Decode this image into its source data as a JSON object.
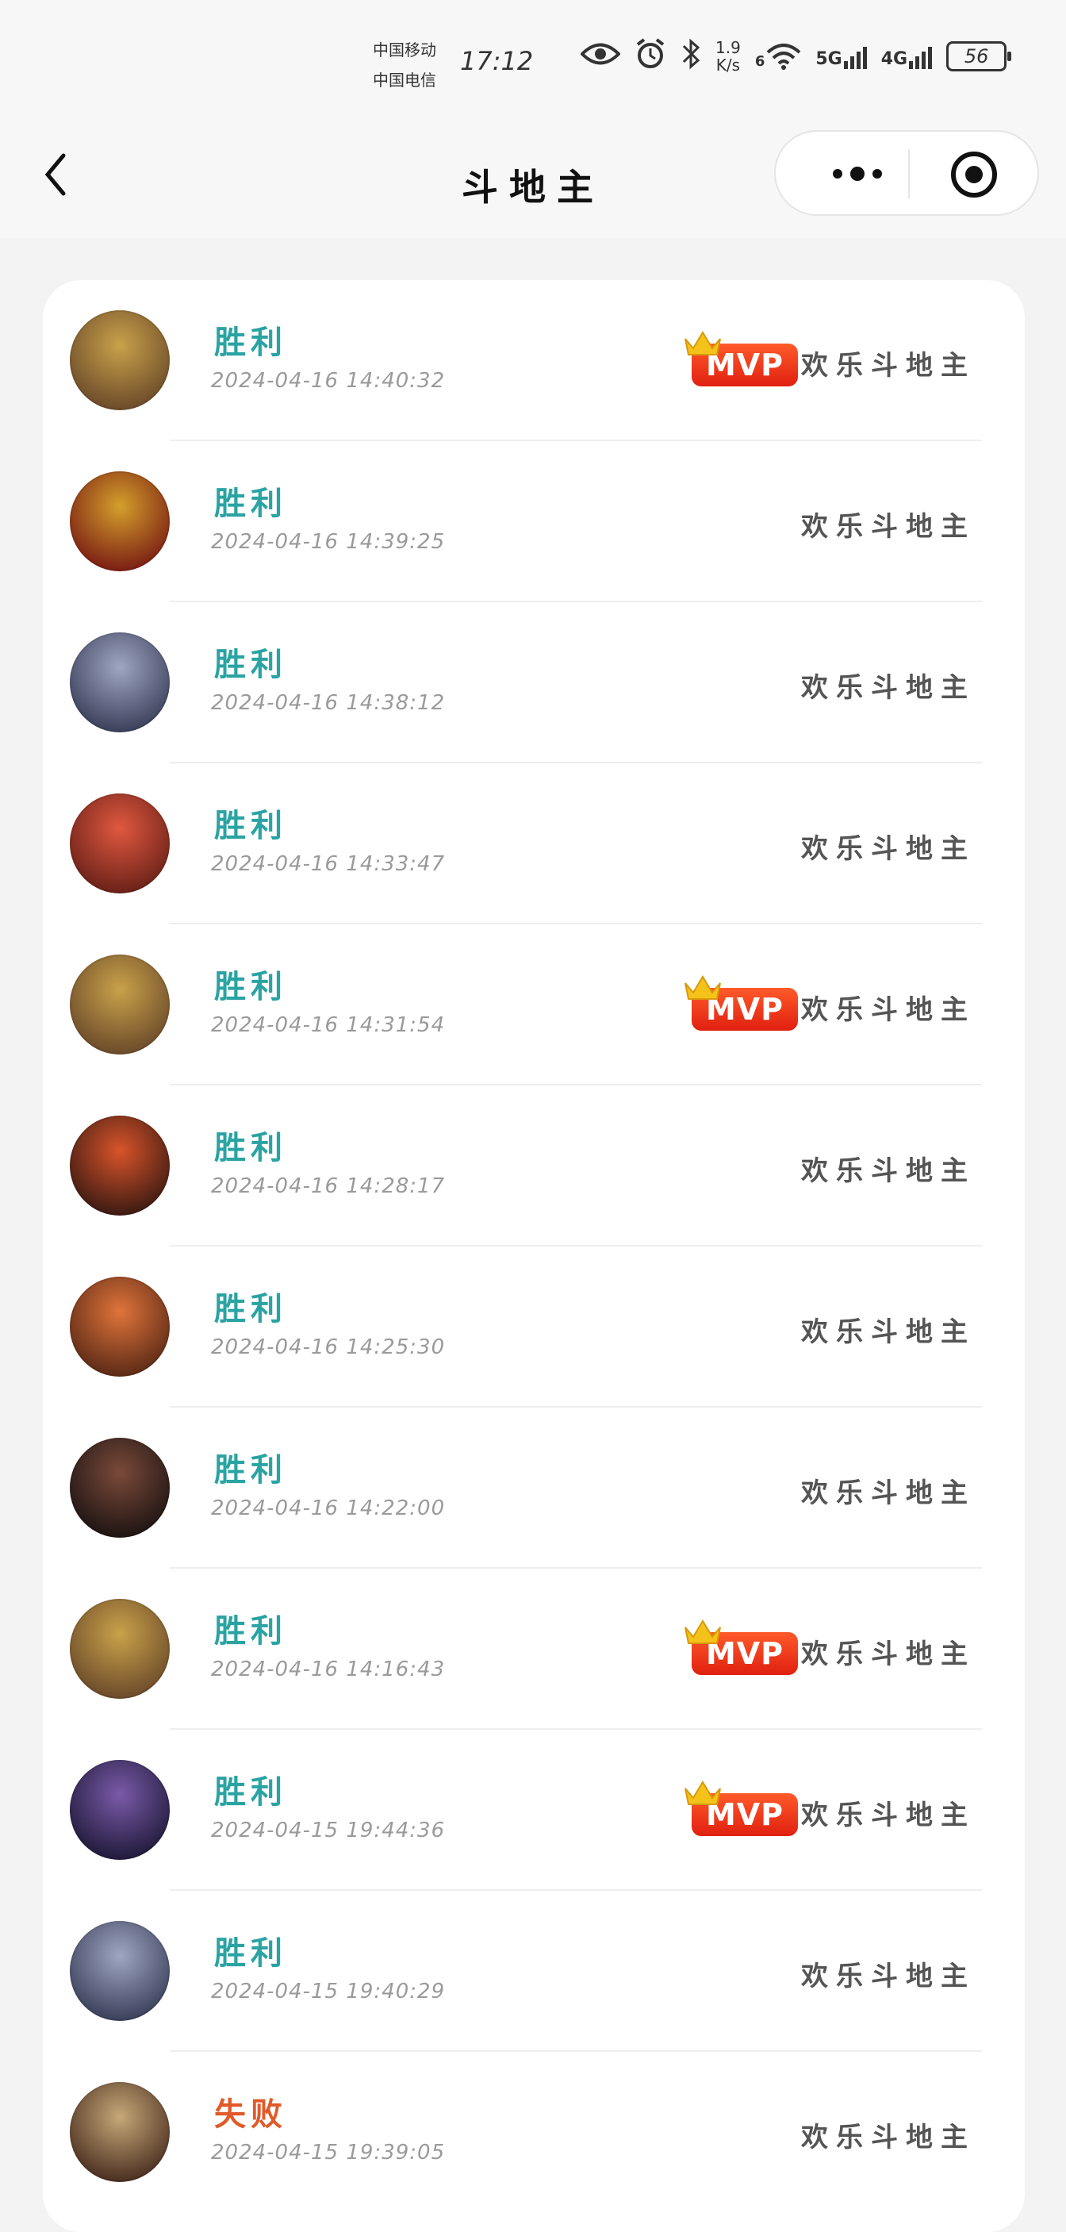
{
  "status_bar": {
    "carrier_1": "中国移动",
    "carrier_2": "中国电信",
    "time": "17:12",
    "net_speed_value": "1.9",
    "net_speed_unit": "K/s",
    "wifi_badge": "6",
    "net_1": "5G",
    "net_2": "4G",
    "battery": "56"
  },
  "header": {
    "title": "斗地主"
  },
  "colors": {
    "win": "#2aa3a3",
    "lose": "#e05a2a",
    "mvp": "#e83d1a"
  },
  "mvp_label": "MVP",
  "records": [
    {
      "result": "胜利",
      "outcome": "win",
      "time": "2024-04-16 14:40:32",
      "mode": "欢乐斗地主",
      "mvp": true,
      "avatar_colors": [
        "#c9a24a",
        "#6b4a2a"
      ]
    },
    {
      "result": "胜利",
      "outcome": "win",
      "time": "2024-04-16 14:39:25",
      "mode": "欢乐斗地主",
      "mvp": false,
      "avatar_colors": [
        "#d4a02b",
        "#7a1d14"
      ]
    },
    {
      "result": "胜利",
      "outcome": "win",
      "time": "2024-04-16 14:38:12",
      "mode": "欢乐斗地主",
      "mvp": false,
      "avatar_colors": [
        "#9fa6c2",
        "#3a3f5a"
      ]
    },
    {
      "result": "胜利",
      "outcome": "win",
      "time": "2024-04-16 14:33:47",
      "mode": "欢乐斗地主",
      "mvp": false,
      "avatar_colors": [
        "#e05840",
        "#6a2118"
      ]
    },
    {
      "result": "胜利",
      "outcome": "win",
      "time": "2024-04-16 14:31:54",
      "mode": "欢乐斗地主",
      "mvp": true,
      "avatar_colors": [
        "#c9a24a",
        "#6b4a2a"
      ]
    },
    {
      "result": "胜利",
      "outcome": "win",
      "time": "2024-04-16 14:28:17",
      "mode": "欢乐斗地主",
      "mvp": false,
      "avatar_colors": [
        "#d8542a",
        "#3b1a12"
      ]
    },
    {
      "result": "胜利",
      "outcome": "win",
      "time": "2024-04-16 14:25:30",
      "mode": "欢乐斗地主",
      "mvp": false,
      "avatar_colors": [
        "#e0743a",
        "#5a2a16"
      ]
    },
    {
      "result": "胜利",
      "outcome": "win",
      "time": "2024-04-16 14:22:00",
      "mode": "欢乐斗地主",
      "mvp": false,
      "avatar_colors": [
        "#7a4a3a",
        "#1e1412"
      ]
    },
    {
      "result": "胜利",
      "outcome": "win",
      "time": "2024-04-16 14:16:43",
      "mode": "欢乐斗地主",
      "mvp": true,
      "avatar_colors": [
        "#c9a24a",
        "#6b4a2a"
      ]
    },
    {
      "result": "胜利",
      "outcome": "win",
      "time": "2024-04-15 19:44:36",
      "mode": "欢乐斗地主",
      "mvp": true,
      "avatar_colors": [
        "#7a5aa8",
        "#201a3a"
      ]
    },
    {
      "result": "胜利",
      "outcome": "win",
      "time": "2024-04-15 19:40:29",
      "mode": "欢乐斗地主",
      "mvp": false,
      "avatar_colors": [
        "#9fa6c2",
        "#3a3f5a"
      ]
    },
    {
      "result": "失败",
      "outcome": "lose",
      "time": "2024-04-15 19:39:05",
      "mode": "欢乐斗地主",
      "mvp": false,
      "avatar_colors": [
        "#c6a878",
        "#4a2e20"
      ]
    }
  ]
}
